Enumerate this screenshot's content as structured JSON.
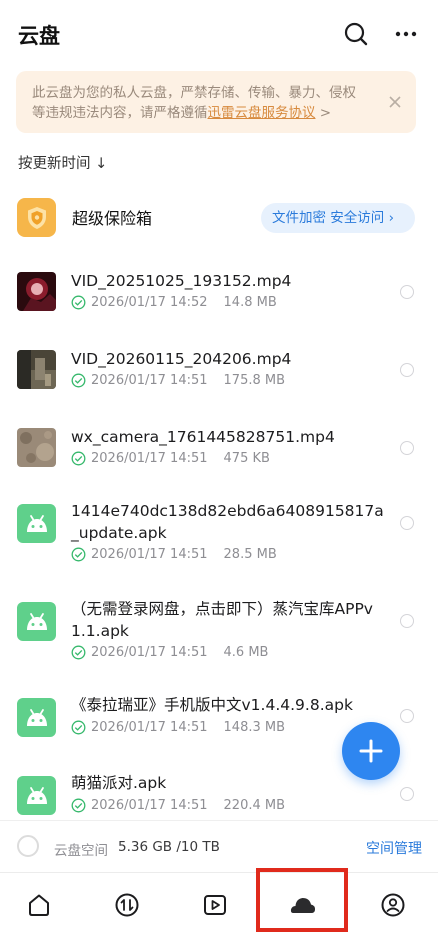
{
  "header": {
    "title": "云盘",
    "search_icon": "search-icon",
    "more_icon": "more-icon"
  },
  "notice": {
    "text": "此云盘为您的私人云盘，严禁存储、传输、暴力、侵权等违规违法内容，请严格遵循",
    "link": "迅雷云盘服务协议",
    "suffix": " >"
  },
  "sort": {
    "label": "按更新时间 ↓"
  },
  "vault": {
    "name": "超级保险箱",
    "pill": "文件加密 安全访问 ›"
  },
  "files": [
    {
      "name": "VID_20251025_193152.mp4",
      "date": "2026/01/17 14:52",
      "size": "14.8 MB"
    },
    {
      "name": "VID_20260115_204206.mp4",
      "date": "2026/01/17 14:51",
      "size": "175.8 MB"
    },
    {
      "name": "wx_camera_1761445828751.mp4",
      "date": "2026/01/17 14:51",
      "size": "475 KB"
    },
    {
      "name": "1414e740dc138d82ebd6a6408915817a_update.apk",
      "date": "2026/01/17 14:51",
      "size": "28.5 MB"
    },
    {
      "name": "（无需登录网盘，点击即下）蒸汽宝库APPv1.1.apk",
      "date": "2026/01/17 14:51",
      "size": "4.6 MB"
    },
    {
      "name": "《泰拉瑞亚》手机版中文v1.4.4.9.8.apk",
      "date": "2026/01/17 14:51",
      "size": "148.3 MB"
    },
    {
      "name": "萌猫派对.apk",
      "date": "2026/01/17 14:51",
      "size": "220.4 MB"
    }
  ],
  "storage": {
    "label": "云盘空间",
    "value": "5.36 GB /10 TB",
    "manage": "空间管理"
  },
  "colors": {
    "accent": "#2e86f0",
    "link": "#2b7bdb",
    "apk": "#5fd08b",
    "highlight": "#e02a1c"
  }
}
